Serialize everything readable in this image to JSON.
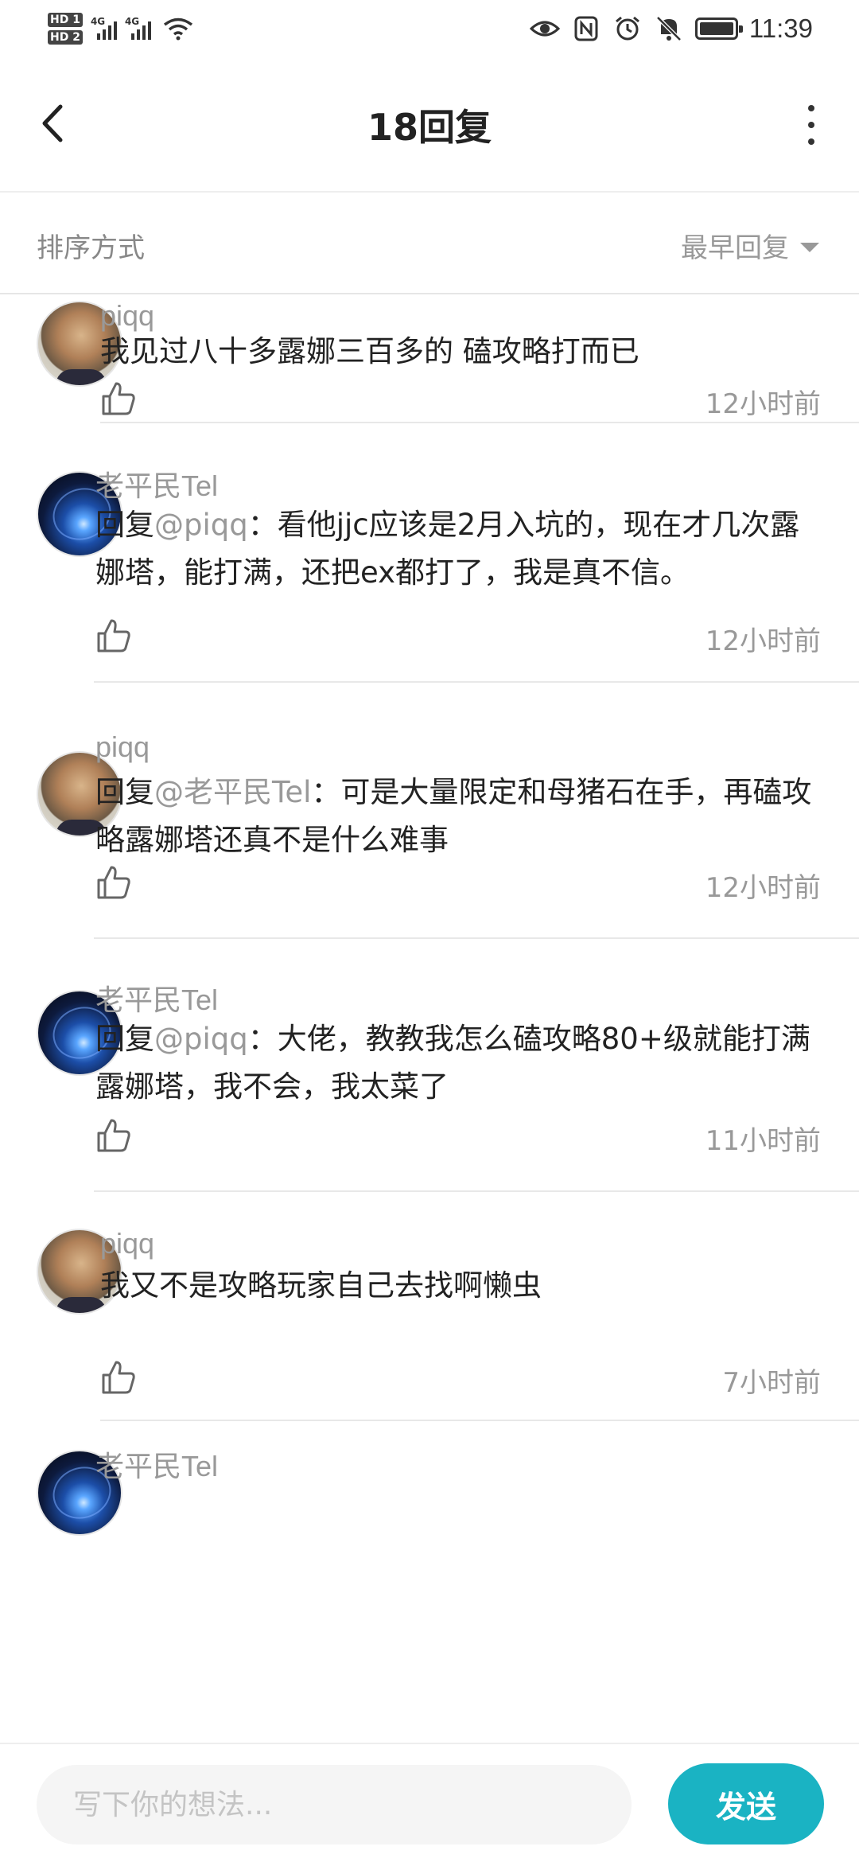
{
  "status_bar": {
    "sim1": "HD 1",
    "sim2": "HD 2",
    "network1": "4G",
    "network2": "4G",
    "time": "11:39",
    "icons": [
      "eye-icon",
      "nfc-icon",
      "alarm-icon",
      "mute-icon",
      "battery-icon"
    ]
  },
  "header": {
    "title": "18回复",
    "back_icon": "chevron-left-icon",
    "more_icon": "more-vertical-icon"
  },
  "sort": {
    "label": "排序方式",
    "selected": "最早回复"
  },
  "comments": [
    {
      "user": "piqq",
      "avatar": "cat",
      "prefix": "",
      "mention": "",
      "text": "我见过八十多露娜三百多的 磕攻略打而已",
      "time": "12小时前"
    },
    {
      "user": "老平民Tel",
      "avatar": "space",
      "prefix": "回复",
      "mention": "@piqq",
      "text": "：看他jjc应该是2月入坑的，现在才几次露娜塔，能打满，还把ex都打了，我是真不信。",
      "time": "12小时前"
    },
    {
      "user": "piqq",
      "avatar": "cat",
      "prefix": "回复",
      "mention": "@老平民Tel",
      "text": "：可是大量限定和母猪石在手，再磕攻略露娜塔还真不是什么难事",
      "time": "12小时前"
    },
    {
      "user": "老平民Tel",
      "avatar": "space",
      "prefix": "回复",
      "mention": "@piqq",
      "text": "：大佬，教教我怎么磕攻略80+级就能打满露娜塔，我不会，我太菜了",
      "time": "11小时前"
    },
    {
      "user": "piqq",
      "avatar": "cat",
      "prefix": "",
      "mention": "",
      "text": "我又不是攻略玩家自己去找啊懒虫",
      "time": "7小时前"
    },
    {
      "user": "老平民Tel",
      "avatar": "space",
      "prefix": "",
      "mention": "",
      "text": "",
      "time": ""
    }
  ],
  "composer": {
    "placeholder": "写下你的想法...",
    "send_label": "发送",
    "accent": "#1ab3c3"
  }
}
